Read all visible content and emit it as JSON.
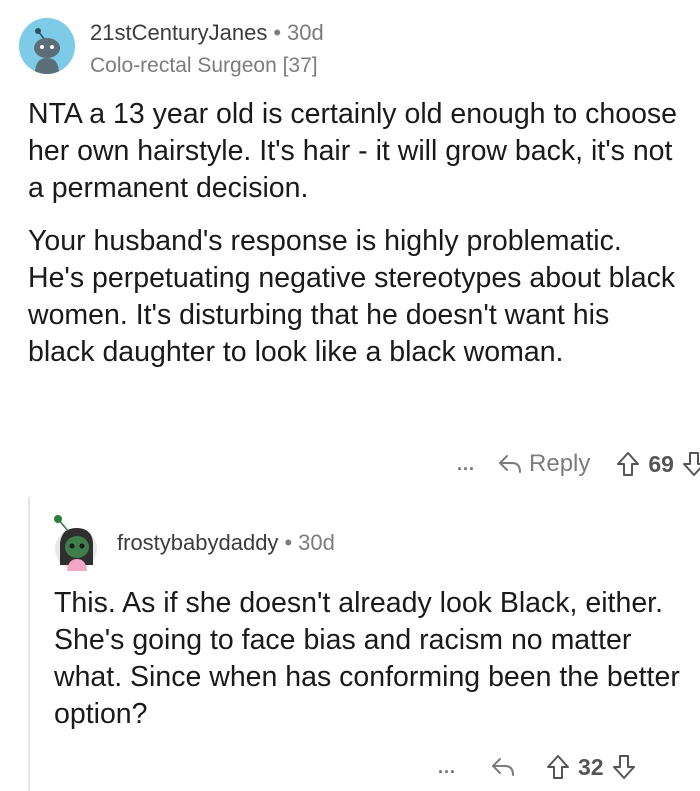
{
  "top_comment": {
    "username": "21stCenturyJanes",
    "separator": "•",
    "age": "30d",
    "flair": "Colo-rectal Surgeon [37]",
    "paragraphs": [
      "NTA a 13 year old is certainly old enough to choose her own hairstyle.  It's hair - it will grow back, it's not a permanent decision.",
      "Your husband's response is highly problematic. He's perpetuating negative stereotypes about black women. It's disturbing that he doesn't want his black daughter to look like a black woman."
    ],
    "more_label": "...",
    "reply_label": "Reply",
    "score": "69",
    "icons": {
      "avatar": "snoo-avatar-icon",
      "reply": "reply-arrow-icon",
      "upvote": "upvote-arrow-icon",
      "downvote": "downvote-arrow-icon"
    }
  },
  "reply_comment": {
    "username": "frostybabydaddy",
    "separator": "•",
    "age": "30d",
    "text": "This. As if she doesn't already look Black, either. She's going to face bias and racism no matter what. Since when has conforming been the better option?",
    "more_label": "...",
    "score": "32",
    "icons": {
      "avatar": "snoo-avatar-icon",
      "reply": "reply-arrow-icon",
      "upvote": "upvote-arrow-icon",
      "downvote": "downvote-arrow-icon"
    }
  },
  "colors": {
    "avatar1_bg": "#7ecbe8",
    "avatar2_head": "#3f7d4a",
    "meta_text": "#7c7c7c",
    "body_text": "#1a1a1b"
  }
}
